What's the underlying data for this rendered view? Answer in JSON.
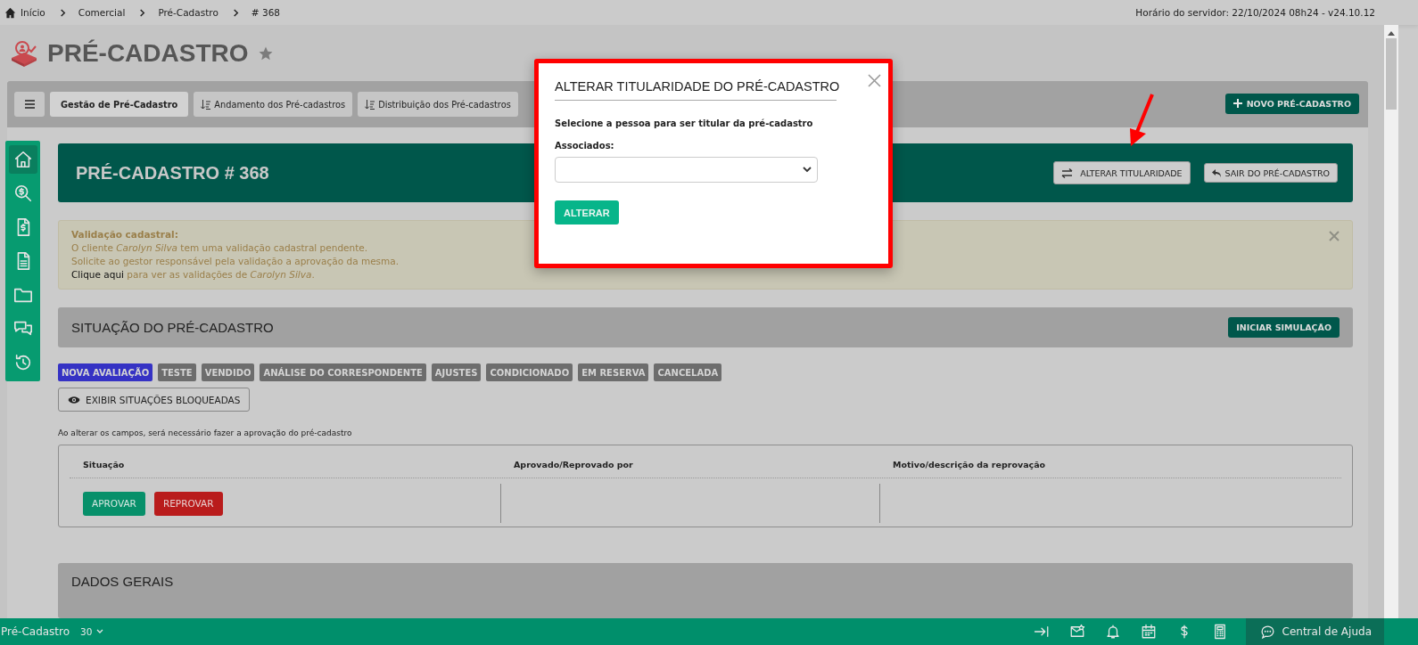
{
  "breadcrumb": [
    {
      "label": "Início"
    },
    {
      "label": "Comercial"
    },
    {
      "label": "Pré-Cadastro"
    },
    {
      "label": "# 368"
    }
  ],
  "server_info": "Horário do servidor: 22/10/2024 08h24 - v24.10.12",
  "page_title": "PRÉ-CADASTRO",
  "favorite": false,
  "tabs": [
    {
      "label": "Gestão de Pré-Cadastro",
      "selected": true,
      "sorted": false
    },
    {
      "label": "Andamento dos Pré-cadastros",
      "selected": false,
      "sorted": true
    },
    {
      "label": "Distribuição dos Pré-cadastros",
      "selected": false,
      "sorted": true
    }
  ],
  "new_button": "NOVO PRÉ-CADASTRO",
  "sidebar": [
    {
      "kind": "home",
      "selected": true
    },
    {
      "kind": "search-dollar",
      "selected": false
    },
    {
      "kind": "invoice",
      "selected": false
    },
    {
      "kind": "document",
      "selected": false
    },
    {
      "kind": "folder",
      "selected": false
    },
    {
      "kind": "chat",
      "selected": false
    },
    {
      "kind": "history",
      "selected": false
    }
  ],
  "record": {
    "title": "PRÉ-CADASTRO # 368",
    "buttons": [
      {
        "kind": "swap",
        "label": "ALTERAR TITULARIDADE"
      },
      {
        "kind": "exit",
        "label": "SAIR DO PRÉ-CADASTRO"
      }
    ]
  },
  "alert": {
    "title": "Validação cadastral:",
    "lines": [
      "O cliente *Carolyn Silva* tem uma validação cadastral pendente.",
      "Solicite ao gestor responsável pela validação a aprovação da mesma."
    ],
    "link": "Clique aqui",
    "link_text": "para ver as validações de *Carolyn Silva*."
  },
  "status_section": {
    "title": "SITUAÇÃO DO PRÉ-CADASTRO",
    "button": "INICIAR SIMULAÇÃO",
    "statuses": [
      {
        "label": "NOVA AVALIAÇÃO",
        "selected": true
      },
      {
        "label": "TESTE",
        "selected": false
      },
      {
        "label": "VENDIDO",
        "selected": false
      },
      {
        "label": "ANÁLISE DO CORRESPONDENTE",
        "selected": false
      },
      {
        "label": "AJUSTES",
        "selected": false
      },
      {
        "label": "CONDICIONADO",
        "selected": false
      },
      {
        "label": "EM RESERVA",
        "selected": false
      },
      {
        "label": "CANCELADA",
        "selected": false
      }
    ],
    "toggle_button": "EXIBIR SITUAÇÕES BLOQUEADAS",
    "note": "Ao alterar os campos, será necessário fazer a aprovação do pré-cadastro",
    "columns": [
      "Situação",
      "Aprovado/Reprovado por",
      "Motivo/descrição da reprovação"
    ],
    "approve": "APROVAR",
    "reject": "REPROVAR"
  },
  "general_section": {
    "title": "DADOS GERAIS"
  },
  "bottom_bar": {
    "module": "Pré-Cadastro",
    "count": "30",
    "icons": [
      {
        "kind": "collapse"
      },
      {
        "kind": "envelope-star"
      },
      {
        "kind": "bell"
      },
      {
        "kind": "calendar"
      },
      {
        "kind": "dollar"
      },
      {
        "kind": "calculator"
      }
    ],
    "help": "Central de Ajuda"
  },
  "modal": {
    "title": "ALTERAR TITULARIDADE DO PRÉ-CADASTRO",
    "instruction": "Selecione a pessoa para ser titular da pré-cadastro",
    "field_label": "Associados:",
    "button": "ALTERAR"
  }
}
